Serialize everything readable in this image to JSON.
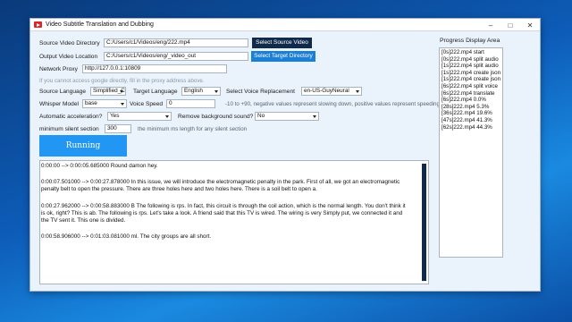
{
  "window": {
    "title": "Video Subtitle Translation and Dubbing"
  },
  "source_dir": {
    "label": "Source Video Directory",
    "value": "C:/Users/c1/Videos/eng/222.mp4",
    "button": "Select Source Video"
  },
  "output_loc": {
    "label": "Output Video Location",
    "value": "C:/Users/c1/Videos/eng/_video_out",
    "button": "Select Target Directory"
  },
  "proxy": {
    "label": "Network Proxy",
    "value": "http://127.0.0.1:10809",
    "hint": "If you cannot access google directly, fill in the proxy address above."
  },
  "language": {
    "source_label": "Source Language",
    "source_value": "Simplified_C",
    "target_label": "Target Language",
    "target_value": "English",
    "voice_label": "Select Voice Replacement",
    "voice_value": "en-US-GuyNeural"
  },
  "whisper": {
    "model_label": "Whisper Model",
    "model_value": "base",
    "speed_label": "Voice Speed",
    "speed_value": "0",
    "speed_hint": "-10 to +90, negative values represent slowing down, positive values represent speeding up"
  },
  "accel": {
    "label": "Automatic acceleration?",
    "value": "Yes",
    "bg_label": "Remove background sound?",
    "bg_value": "No"
  },
  "silent": {
    "label": "minimum silent section",
    "value": "300",
    "hint": "the minimum ms length for any silent section"
  },
  "run_button": "Running",
  "output_text": [
    "0:00:00 --> 0:00:05.685000 Round damon hey.",
    "0:00:07.501000 --> 0:00:27.878000 In this issue, we will introduce the electromagnetic penalty in the park. First of all, we got an electromagnetic penalty belt to open the pressure. There are three holes here and two holes here. There is a soil belt to open a.",
    "0:00:27.962000 --> 0:00:58.883000 B The following is rps. In fact, this circuit is through the coil action, which is the normal length. You don't think it is ok, right? This is ab. The following is rps. Let's take a look. A friend said that this TV is wired. The wiring is very Simply put, we connected it and the TV sent it. This one is divided.",
    "0:00:58.906000 --> 0:01:03.081000 ml. The city groups are all short."
  ],
  "progress": {
    "title": "Progress Display Area",
    "lines": [
      "[0s]222.mp4 start",
      "[0s]222.mp4 split audio",
      "[1s]222.mp4 split audio",
      "[1s]222.mp4 create json",
      "[1s]222.mp4 create json",
      "[6s]222.mp4 split voice",
      "[6s]222.mp4 translate",
      "[6s]222.mp4 0.0%",
      "[28s]222.mp4 5.3%",
      "[36s]222.mp4 19.6%",
      "[47s]222.mp4 41.3%",
      "[62s]222.mp4 44.3%"
    ]
  }
}
